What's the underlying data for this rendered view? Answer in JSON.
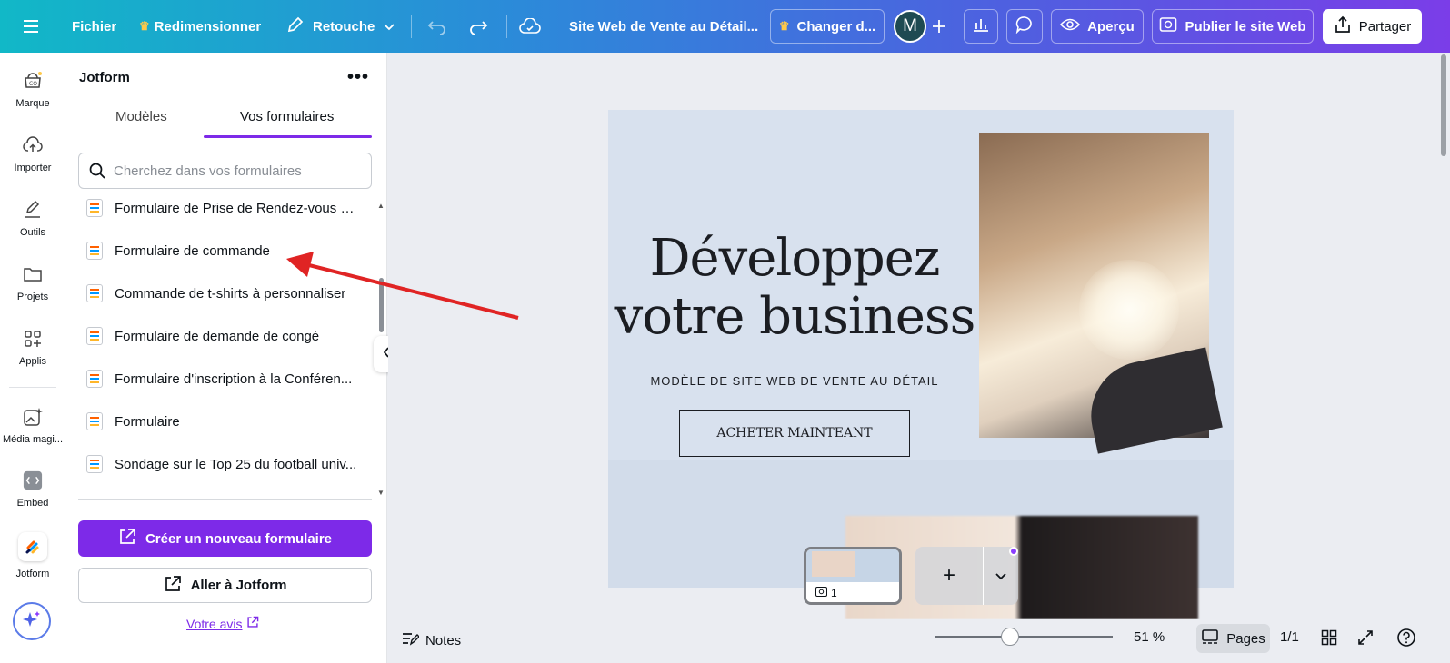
{
  "topbar": {
    "file": "Fichier",
    "resize": "Redimensionner",
    "edit": "Retouche",
    "doc_title": "Site Web de Vente au Détail...",
    "change_label": "Changer d...",
    "avatar_initial": "M",
    "preview": "Aperçu",
    "publish": "Publier le site Web",
    "share": "Partager"
  },
  "rail": {
    "items": [
      {
        "label": "Marque"
      },
      {
        "label": "Importer"
      },
      {
        "label": "Outils"
      },
      {
        "label": "Projets"
      },
      {
        "label": "Applis"
      },
      {
        "label": "Média magi..."
      },
      {
        "label": "Embed"
      },
      {
        "label": "Jotform"
      }
    ]
  },
  "panel": {
    "title": "Jotform",
    "more": "•••",
    "tabs": [
      {
        "label": "Modèles"
      },
      {
        "label": "Vos formulaires"
      }
    ],
    "search_placeholder": "Cherchez dans vos formulaires",
    "forms": [
      {
        "label": "Formulaire de Prise de Rendez-vous M..."
      },
      {
        "label": "Formulaire de commande"
      },
      {
        "label": "Commande de t-shirts à personnaliser"
      },
      {
        "label": "Formulaire de demande de congé"
      },
      {
        "label": "Formulaire d'inscription à la Conféren..."
      },
      {
        "label": "Formulaire"
      },
      {
        "label": "Sondage sur le Top 25 du football univ..."
      }
    ],
    "create_button": "Créer un nouveau formulaire",
    "goto_button": "Aller à Jotform",
    "feedback": "Votre avis"
  },
  "canvas": {
    "headline_line1": "Développez",
    "headline_line2": "votre business",
    "subline": "MODÈLE DE SITE WEB DE VENTE AU DÉTAIL",
    "cta": "ACHETER MAINTEANT"
  },
  "thumbnails": {
    "page_number": "1"
  },
  "bottombar": {
    "notes": "Notes",
    "zoom": "51 %",
    "pages": "Pages",
    "page_count": "1/1"
  },
  "colors": {
    "accent": "#7d2ae8",
    "arrow": "#e02424"
  }
}
